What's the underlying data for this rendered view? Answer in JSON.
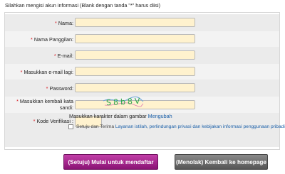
{
  "intro_text": "Silahkan mengisi akun informasi (Blank dengan tanda \"*\" harus diisi)",
  "required_mark": "*",
  "fields": {
    "nama": {
      "label": "Nama:",
      "value": ""
    },
    "nama_panggilan": {
      "label": "Nama Panggilan:",
      "value": ""
    },
    "email": {
      "label": "E-mail:",
      "value": ""
    },
    "email_confirm": {
      "label": "Masukkan e-mail lagi:",
      "value": ""
    },
    "password": {
      "label": "Password:",
      "value": ""
    },
    "password_confirm": {
      "label_line1": "Masukkan kembali kata",
      "label_line2": "sandi:",
      "value": ""
    },
    "kode_verifikasi": {
      "label": "Kode Verifikasi :",
      "value": ""
    }
  },
  "captcha": {
    "text": "S8b8V",
    "color": "#2fa84a"
  },
  "captcha_help": {
    "text": "Masukkan karakter dalam gambar",
    "link": "Mengubah"
  },
  "agreement": {
    "prefix": "Setuju dan Terima",
    "link": "Layanan istilah, perlindungan privasi dan kebijakan informasi penggunaan pribadi",
    "checked": false
  },
  "buttons": {
    "register": "(Setuju) Mulai untuk mendaftar",
    "back": "(Menolak) Kembali ke homepage"
  },
  "colors": {
    "input_bg": "#fff2ce",
    "register_button": "#a8268f",
    "back_button": "#6e6e6e",
    "required": "#d8141c",
    "link": "#1a5fa8"
  }
}
